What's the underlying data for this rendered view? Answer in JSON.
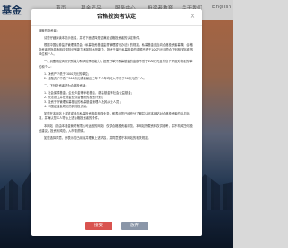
{
  "site": {
    "logo_text": "基金",
    "nav": [
      "首页",
      "基金产品",
      "服务中心",
      "投资者教育",
      "关于我们",
      "English"
    ]
  },
  "modal": {
    "title": "合格投资者认定",
    "close_label": "×",
    "greeting": "尊敬的投资者：",
    "paragraphs": [
      "请您仔细阅读本提示信息，并在下面选择是否满足合格投资者的认定条件。",
      "根据中国证券监督管理委员会《私募投资基金监督管理暂行办法》的规定，私募基金应当向合格投资者募集，合格投资者是指具备相应风险识别能力和风险承担能力，投资于单只私募基金的金额不低于100万元且符合下列相关标准的单位和个人。",
      "一、具备相应风险识别能力和风险承担能力，投资于单只私募基金的金额不低于100万元且符合下列相关标准的单位和个人：",
      "二、下列投资者视为合格投资者：",
      "如您在本网站上浏览或参与私募投资基金相关业务，即表示您已经充分了解并认可本网站对合格投资者的认定标准，并确认您本人符合上述合格投资者的条件。"
    ],
    "list_one": [
      "1. 净资产不低于1000万元的单位；",
      "2. 金融资产不低于300万元或者最近三年个人年均收入不低于50万元的个人。"
    ],
    "list_two": [
      "1. 社会保障基金、企业年金等养老基金，慈善基金等社会公益基金；",
      "2. 依法设立并在基金业协会备案的投资计划；",
      "3. 投资于所管理私募基金的私募基金管理人及其从业人员；",
      "4. 中国证监会规定的其他投资者。"
    ],
    "statement": "本网站（指由本基金管理有限公司运营的网站）仅供合格投资者浏览，本网站所载资料仅供参考，并不构成任何投资建议。投资有风险，入市需谨慎。",
    "closing": "如您选择同意，即表示您已阅读并理解上述内容，并同意遵守本网站的相关规定。",
    "agree_label": "接受",
    "decline_label": "放弃"
  }
}
